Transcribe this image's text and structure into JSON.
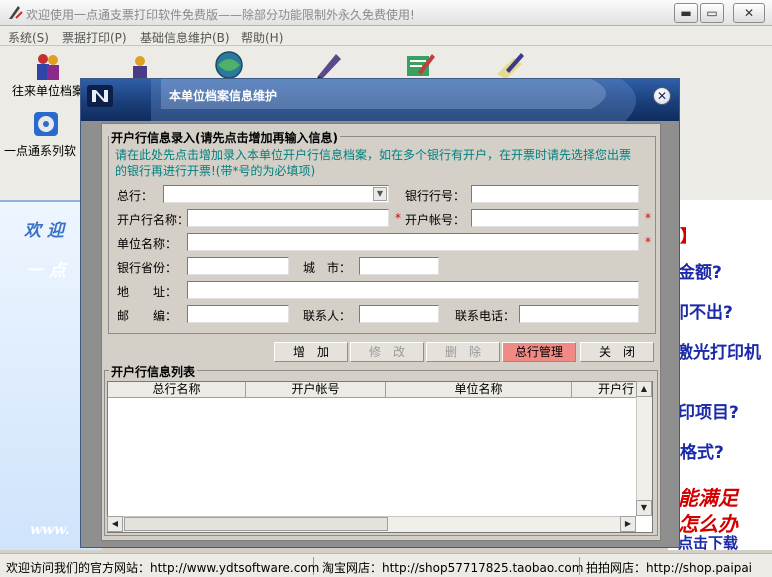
{
  "window": {
    "title": "欢迎使用一点通支票打印软件免费版——除部分功能限制外永久免费使用!",
    "minimize": "▬",
    "restore": "▭",
    "close": "✕"
  },
  "menu": [
    {
      "label": "系统(S)"
    },
    {
      "label": "票据打印(P)"
    },
    {
      "label": "基础信息维护(B)"
    },
    {
      "label": "帮助(H)"
    }
  ],
  "toolbar": {
    "btn1_label": "往来单位档案",
    "btn2_label": "一点通系列软"
  },
  "background": {
    "left_line1": "欢 迎",
    "left_line2": "一 点",
    "left_url": "www.",
    "right_lines": [
      "】",
      "金额?",
      "印不出?",
      "激光打印机",
      "印项目?",
      "格式?"
    ],
    "right_red1": "能满足",
    "right_red2": "怎么办",
    "right_download": "点击下载"
  },
  "status": {
    "seg1": "欢迎访问我们的官方网站：http://www.ydtsoftware.com",
    "seg2": "淘宝网店：http://shop57717825.taobao.com",
    "seg3": "拍拍网店：http://shop.paipai"
  },
  "dialog": {
    "title": "本单位档案信息维护",
    "close": "✕",
    "group1_legend": "开户行信息录入(请先点击增加再输入信息)",
    "hint_line1": "请在此处先点击增加录入本单位开户行信息档案，如在多个银行有开户，在开票时请先选择您出票",
    "hint_line2": "的银行再进行开票!(带*号的为必填项)",
    "labels": {
      "bank_head": "总行：",
      "bank_no": "银行行号：",
      "bank_name": "开户行名称：",
      "account_no": "开户帐号：",
      "unit_name": "单位名称：",
      "province": "银行省份：",
      "city": "城　市：",
      "address": "地　　址：",
      "postcode": "邮　　编：",
      "contact": "联系人：",
      "phone": "联系电话："
    },
    "required_mark": "*",
    "fields": {
      "bank_head": "",
      "bank_no": "",
      "bank_name": "",
      "account_no": "",
      "unit_name": "",
      "province": "",
      "city": "",
      "address": "",
      "postcode": "",
      "contact": "",
      "phone": ""
    },
    "buttons": {
      "add": "增　加",
      "edit": "修　改",
      "delete": "删　除",
      "bank_manage": "总行管理",
      "close": "关　闭"
    },
    "group2_legend": "开户行信息列表",
    "columns": [
      "总行名称",
      "开户帐号",
      "单位名称",
      "开户行"
    ]
  }
}
